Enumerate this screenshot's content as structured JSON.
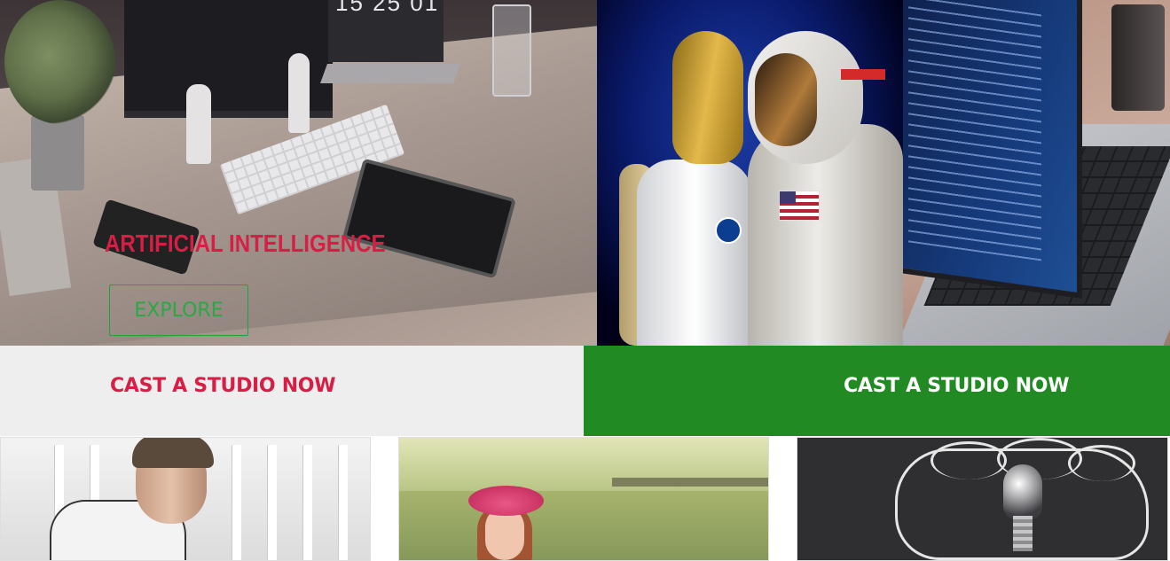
{
  "hero": {
    "title": "ARTIFICIAL INTELLIGENCE",
    "explore_label": "EXPLORE",
    "clock": "15 25 01",
    "colors": {
      "title": "#d71e45",
      "button": "#2ba846"
    }
  },
  "cta": {
    "left_label": "CAST A STUDIO NOW",
    "right_label": "CAST A STUDIO NOW",
    "colors": {
      "left_bg": "#eeeeee",
      "left_text": "#d71e45",
      "right_bg": "#228a22",
      "right_text": "#ffffff"
    }
  },
  "images": {
    "hero": [
      "desk-workspace-photo",
      "robot-and-astronaut-photo",
      "laptop-code-photo"
    ],
    "cards": [
      "young-man-photo",
      "girl-in-pink-hat-photo",
      "lightbulb-chalk-cloud-photo"
    ]
  }
}
